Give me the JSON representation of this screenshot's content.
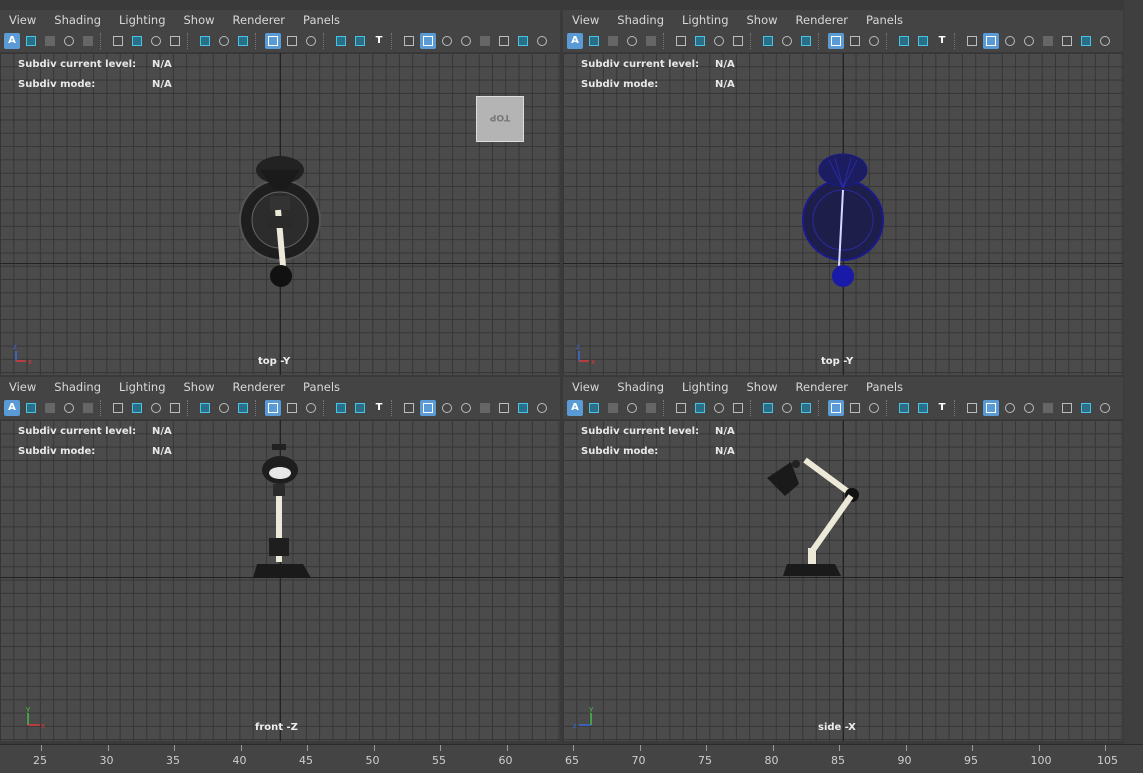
{
  "menus": [
    "View",
    "Shading",
    "Lighting",
    "Show",
    "Renderer",
    "Panels"
  ],
  "hud": {
    "subdiv_level_label": "Subdiv current level:",
    "subdiv_mode_label": "Subdiv mode:",
    "value": "N/A"
  },
  "panes": {
    "top_left": {
      "camera": "top -Y",
      "viewcube": "TOP"
    },
    "top_right": {
      "camera": "top -Y"
    },
    "bottom_left": {
      "camera": "front -Z"
    },
    "bottom_right": {
      "camera": "side -X"
    }
  },
  "gizmo_axes": {
    "top": [
      "x",
      "z"
    ],
    "front": [
      "x",
      "y"
    ],
    "side": [
      "z",
      "y"
    ]
  },
  "timeline": {
    "ticks": [
      "25",
      "30",
      "35",
      "40",
      "45",
      "50",
      "55",
      "60",
      "65",
      "70",
      "75",
      "80",
      "85",
      "90",
      "95",
      "100",
      "105"
    ]
  },
  "colors": {
    "highlight": "#5b9bd5",
    "wireframe": "#1a1a8c",
    "axis_x": "#d93a3a",
    "axis_y": "#49c249",
    "axis_z": "#3a6bd9"
  }
}
